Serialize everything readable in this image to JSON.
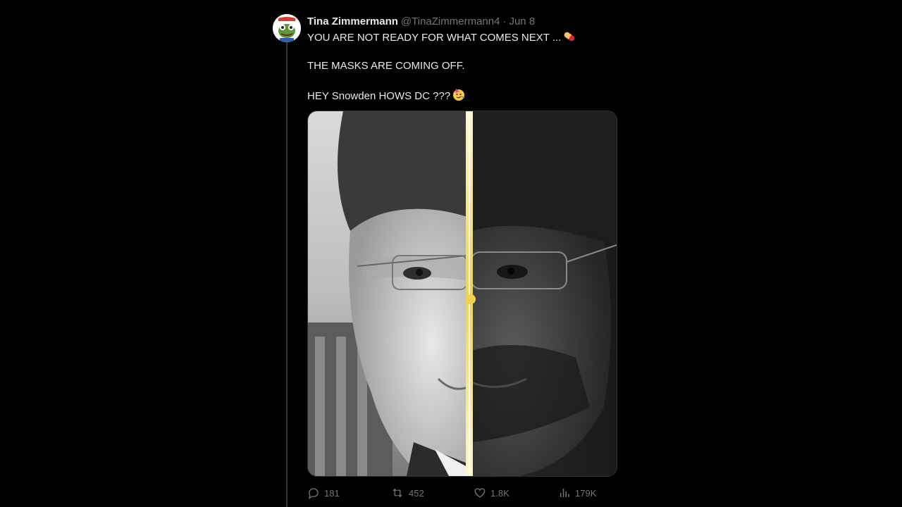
{
  "post": {
    "author_name": "Tina Zimmermann",
    "author_handle": "@TinaZimmermann4",
    "separator": "·",
    "date": "Jun 8",
    "lines": [
      "YOU ARE NOT READY FOR WHAT COMES NEXT ...",
      "THE MASKS ARE COMING OFF.",
      "HEY Snowden HOWS DC ???"
    ],
    "line1_emoji": "pill-emoji",
    "line3_emoji": "partying-face-emoji"
  },
  "metrics": {
    "replies": "181",
    "reposts": "452",
    "likes": "1.8K",
    "views": "179K"
  },
  "colors": {
    "background": "#000000",
    "text_primary": "#e7e9ea",
    "text_secondary": "#71767b",
    "thread_line": "#333639",
    "divider_accent": "#f2d14a"
  },
  "icons": {
    "reply": "reply-icon",
    "repost": "repost-icon",
    "like": "heart-icon",
    "views": "views-icon"
  }
}
